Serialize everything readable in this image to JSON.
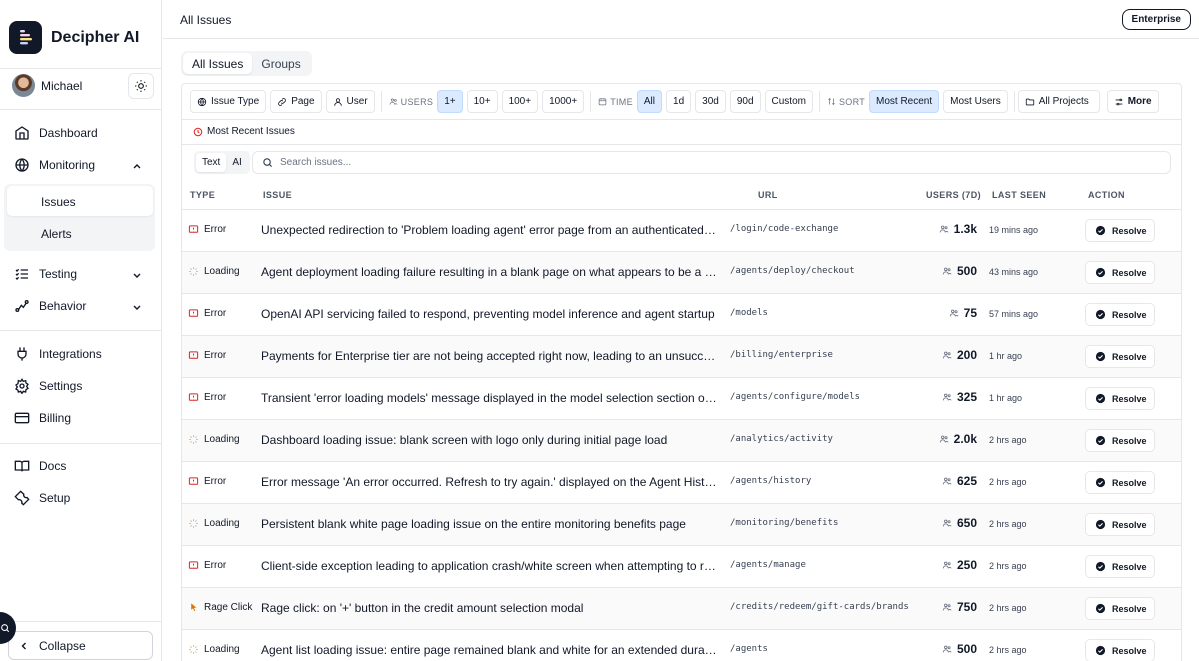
{
  "app": {
    "brand_name": "Decipher AI",
    "user_name": "Michael",
    "page_title": "All Issues",
    "plan_badge": "Enterprise"
  },
  "sidebar": {
    "nav": [
      {
        "label": "Dashboard",
        "icon": "grid-icon"
      },
      {
        "label": "Monitoring",
        "icon": "globe-icon"
      },
      {
        "label": "Testing",
        "icon": "checklist-icon"
      },
      {
        "label": "Behavior",
        "icon": "route-icon"
      },
      {
        "label": "Integrations",
        "icon": "plug-icon"
      },
      {
        "label": "Settings",
        "icon": "gear-icon"
      },
      {
        "label": "Billing",
        "icon": "card-icon"
      },
      {
        "label": "Docs",
        "icon": "book-icon"
      },
      {
        "label": "Setup",
        "icon": "wrench-icon"
      }
    ],
    "monitoring_sub": [
      "Issues",
      "Alerts"
    ],
    "collapse_label": "Collapse"
  },
  "tabs": [
    "All Issues",
    "Groups"
  ],
  "filters": {
    "issue_type": "Issue Type",
    "page": "Page",
    "user": "User",
    "users_label": "USERS",
    "users_options": [
      "1+",
      "10+",
      "100+",
      "1000+"
    ],
    "users_selected": "1+",
    "time_label": "TIME",
    "time_options": [
      "All",
      "1d",
      "30d",
      "90d",
      "Custom"
    ],
    "time_selected": "All",
    "sort_label": "SORT",
    "sort_options": [
      "Most Recent",
      "Most Users"
    ],
    "sort_selected": "Most Recent",
    "projects": "All Projects",
    "more": "More"
  },
  "section_title": "Most Recent Issues",
  "search": {
    "modes": [
      "Text",
      "AI"
    ],
    "mode_selected": "Text",
    "placeholder": "Search issues..."
  },
  "table": {
    "headers": [
      "TYPE",
      "ISSUE",
      "URL",
      "USERS (7D)",
      "LAST SEEN",
      "ACTION"
    ],
    "action_label": "Resolve",
    "rows": [
      {
        "type": "Error",
        "issue": "Unexpected redirection to 'Problem loading agent' error page from an authenticated area a...",
        "url": "/login/code-exchange",
        "users": "1.3k",
        "last_seen": "19 mins ago"
      },
      {
        "type": "Loading",
        "issue": "Agent deployment loading failure resulting in a blank page on what appears to be a checko...",
        "url": "/agents/deploy/checkout",
        "users": "500",
        "last_seen": "43 mins ago"
      },
      {
        "type": "Error",
        "issue": "OpenAI API servicing failed to respond, preventing model inference and agent startup",
        "url": "/models",
        "users": "75",
        "last_seen": "57 mins ago"
      },
      {
        "type": "Error",
        "issue": "Payments for Enterprise tier are not being accepted right now, leading to an unsuccessful u...",
        "url": "/billing/enterprise",
        "users": "200",
        "last_seen": "1 hr ago"
      },
      {
        "type": "Error",
        "issue": "Transient 'error loading models' message displayed in the model selection section of the a...",
        "url": "/agents/configure/models",
        "users": "325",
        "last_seen": "1 hr ago"
      },
      {
        "type": "Loading",
        "issue": "Dashboard loading issue: blank screen with logo only during initial page load",
        "url": "/analytics/activity",
        "users": "2.0k",
        "last_seen": "2 hrs ago"
      },
      {
        "type": "Error",
        "issue": "Error message 'An error occurred. Refresh to try again.' displayed on the Agent History page",
        "url": "/agents/history",
        "users": "625",
        "last_seen": "2 hrs ago"
      },
      {
        "type": "Loading",
        "issue": "Persistent blank white page loading issue on the entire monitoring benefits page",
        "url": "/monitoring/benefits",
        "users": "650",
        "last_seen": "2 hrs ago"
      },
      {
        "type": "Error",
        "issue": "Client-side exception leading to application crash/white screen when attempting to remove...",
        "url": "/agents/manage",
        "users": "250",
        "last_seen": "2 hrs ago"
      },
      {
        "type": "Rage Click",
        "issue": "Rage click: on '+' button in the credit amount selection modal",
        "url": "/credits/redeem/gift-cards/brands",
        "users": "750",
        "last_seen": "2 hrs ago"
      },
      {
        "type": "Loading",
        "issue": "Agent list loading issue: entire page remained blank and white for an extended duration",
        "url": "/agents",
        "users": "500",
        "last_seen": "2 hrs ago"
      }
    ]
  },
  "colors": {
    "error": "#dc2626",
    "loading": "#d6a36b",
    "rage_click": "#d97706",
    "selected_chip": "#dbeafe",
    "text": "#111827"
  }
}
